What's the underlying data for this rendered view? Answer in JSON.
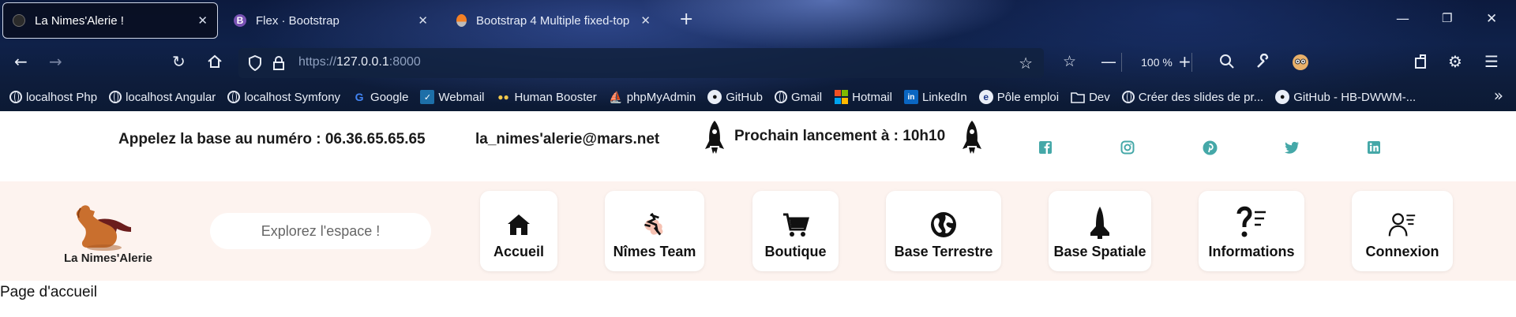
{
  "browser": {
    "tabs": [
      {
        "label": "La Nimes'Alerie !",
        "active": true
      },
      {
        "label": "Flex · Bootstrap",
        "favicon_letter": "B",
        "active": false
      },
      {
        "label": "Bootstrap 4 Multiple fixed-top",
        "active": false
      }
    ],
    "url": {
      "scheme": "https://",
      "host": "127.0.0.1",
      "port": ":8000"
    },
    "zoom": "100 %",
    "bookmarks": [
      {
        "label": "localhost Php",
        "icon": "globe-icon"
      },
      {
        "label": "localhost Angular",
        "icon": "globe-icon"
      },
      {
        "label": "localhost Symfony",
        "icon": "globe-icon"
      },
      {
        "label": "Google",
        "icon": "google-icon"
      },
      {
        "label": "Webmail",
        "icon": "webmail-icon"
      },
      {
        "label": "Human Booster",
        "icon": "human-booster-icon"
      },
      {
        "label": "phpMyAdmin",
        "icon": "phpmyadmin-icon"
      },
      {
        "label": "GitHub",
        "icon": "github-icon"
      },
      {
        "label": "Gmail",
        "icon": "globe-icon"
      },
      {
        "label": "Hotmail",
        "icon": "microsoft-icon"
      },
      {
        "label": "LinkedIn",
        "icon": "linkedin-icon"
      },
      {
        "label": "Pôle emploi",
        "icon": "pole-emploi-icon"
      },
      {
        "label": "Dev",
        "icon": "folder-icon"
      },
      {
        "label": "Créer des slides de pr...",
        "icon": "globe-icon"
      },
      {
        "label": "GitHub - HB-DWWM-...",
        "icon": "github-icon"
      }
    ]
  },
  "site": {
    "phone_text": "Appelez la base au numéro : 06.36.65.65.65",
    "email_text": "la_nimes'alerie@mars.net",
    "launch_text": "Prochain lancement à : 10h10",
    "social": [
      "facebook",
      "instagram",
      "pinterest",
      "twitter",
      "linkedin"
    ],
    "logo_text": "La Nimes'Alerie",
    "search_placeholder": "Explorez l'espace !",
    "nav": [
      {
        "label": "Accueil",
        "icon": "home-icon"
      },
      {
        "label": "Nîmes Team",
        "icon": "team-icon"
      },
      {
        "label": "Boutique",
        "icon": "cart-icon"
      },
      {
        "label": "Base Terrestre",
        "icon": "earth-icon"
      },
      {
        "label": "Base Spatiale",
        "icon": "shuttle-icon"
      },
      {
        "label": "Informations",
        "icon": "info-icon"
      },
      {
        "label": "Connexion",
        "icon": "user-icon"
      }
    ],
    "page_text": "Page d'accueil"
  },
  "colors": {
    "accent_social": "#45a8a8",
    "nav_background": "#fdf3ef"
  }
}
